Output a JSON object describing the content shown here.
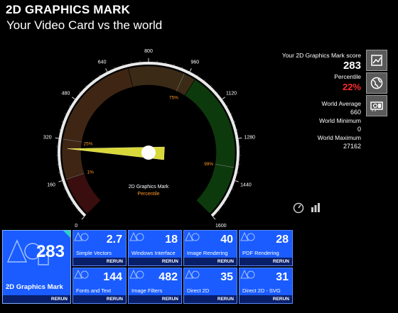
{
  "header": {
    "title": "2D GRAPHICS MARK",
    "subtitle": "Your Video Card vs the world"
  },
  "gauge": {
    "ticks": [
      "0",
      "160",
      "320",
      "480",
      "640",
      "800",
      "960",
      "1120",
      "1280",
      "1440",
      "1600"
    ],
    "center_label": "2D Graphics Mark",
    "center_sublabel": "Percentile",
    "percentile_markers": [
      "1%",
      "25%",
      "75%",
      "99%"
    ],
    "needle_value": 283,
    "max": 1600
  },
  "stats": {
    "score_label": "Your 2D Graphics Mark score",
    "score": "283",
    "percentile_label": "Percentile",
    "percentile": "22%",
    "world_avg_label": "World Average",
    "world_avg": "660",
    "world_min_label": "World Minimum",
    "world_min": "0",
    "world_max_label": "World Maximum",
    "world_max": "27162"
  },
  "main_tile": {
    "score": "283",
    "label": "2D Graphics Mark",
    "rerun": "RERUN"
  },
  "tiles": [
    {
      "score": "2.7",
      "label": "Simple Vectors",
      "rerun": "RERUN"
    },
    {
      "score": "18",
      "label": "Windows Interface",
      "rerun": "RERUN"
    },
    {
      "score": "40",
      "label": "Image Rendering",
      "rerun": "RERUN"
    },
    {
      "score": "28",
      "label": "PDF Rendering",
      "rerun": "RERUN"
    },
    {
      "score": "144",
      "label": "Fonts and Text",
      "rerun": "RERUN"
    },
    {
      "score": "482",
      "label": "Image Filters",
      "rerun": "RERUN"
    },
    {
      "score": "35",
      "label": "Direct 2D",
      "rerun": "RERUN"
    },
    {
      "score": "31",
      "label": "Direct 2D - SVG",
      "rerun": "RERUN"
    }
  ],
  "icons": [
    "chart-icon",
    "globe-icon",
    "video-card-icon",
    "speedometer-icon",
    "bar-chart-icon"
  ]
}
